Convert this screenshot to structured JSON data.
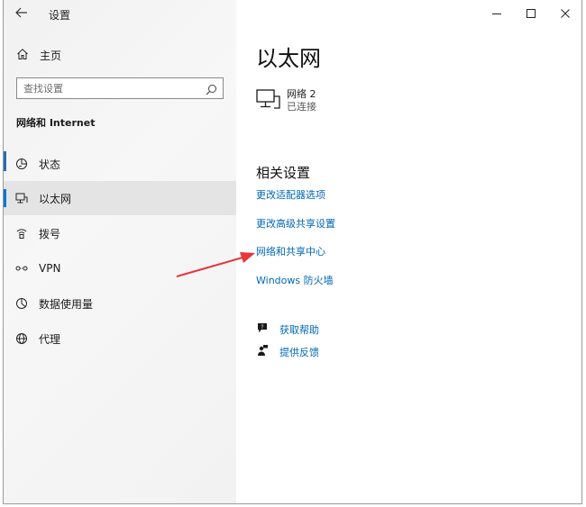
{
  "app": {
    "title": "设置"
  },
  "sidebar": {
    "home_label": "主页",
    "search_placeholder": "查找设置",
    "section_label": "网络和 Internet",
    "items": [
      {
        "label": "状态",
        "icon": "status-icon"
      },
      {
        "label": "以太网",
        "icon": "ethernet-icon",
        "active": true
      },
      {
        "label": "拨号",
        "icon": "dialup-icon"
      },
      {
        "label": "VPN",
        "icon": "vpn-icon"
      },
      {
        "label": "数据使用量",
        "icon": "data-usage-icon"
      },
      {
        "label": "代理",
        "icon": "globe-icon"
      }
    ]
  },
  "main": {
    "title": "以太网",
    "network": {
      "name": "网络 2",
      "status": "已连接"
    },
    "related_title": "相关设置",
    "links": [
      "更改适配器选项",
      "更改高级共享设置",
      "网络和共享中心",
      "Windows 防火墙"
    ],
    "help": [
      {
        "label": "获取帮助",
        "icon": "help-chat-icon"
      },
      {
        "label": "提供反馈",
        "icon": "feedback-icon"
      }
    ]
  },
  "colors": {
    "accent": "#0067b8",
    "annotation_arrow": "#e8353a"
  }
}
